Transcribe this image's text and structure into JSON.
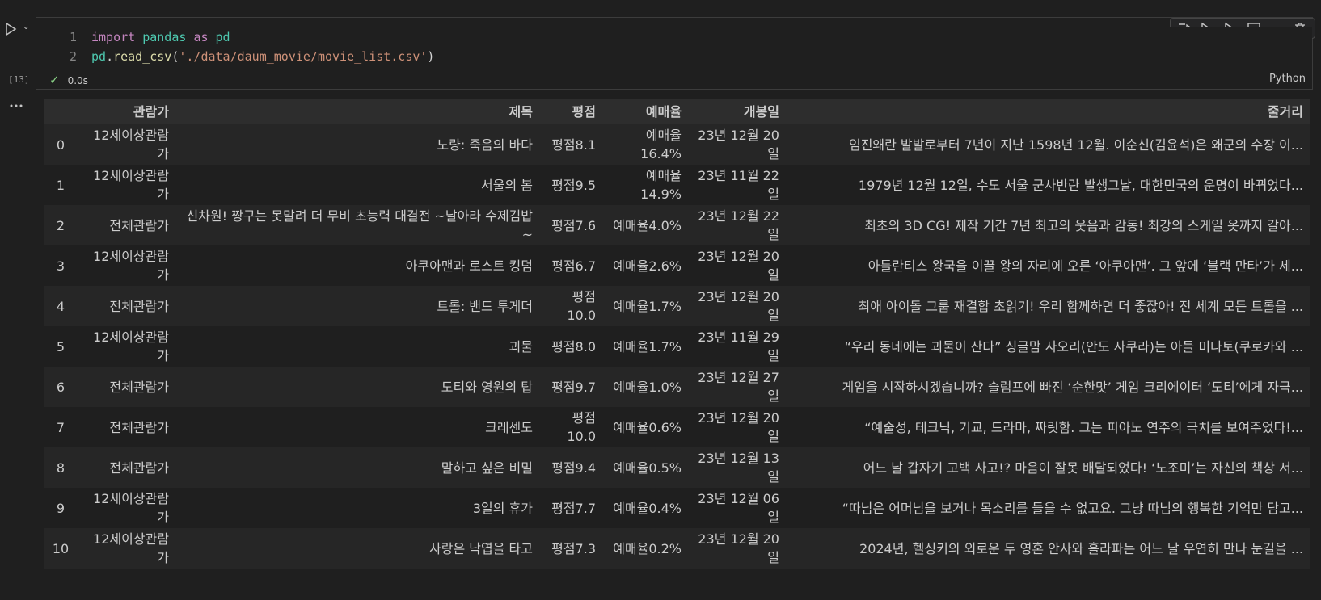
{
  "cell": {
    "execution_count": "[13]",
    "code_lines": [
      {
        "num": "1",
        "tokens": [
          {
            "t": "import",
            "c": "kw"
          },
          {
            "t": " ",
            "c": "pl"
          },
          {
            "t": "pandas",
            "c": "mod"
          },
          {
            "t": " ",
            "c": "pl"
          },
          {
            "t": "as",
            "c": "kw"
          },
          {
            "t": " ",
            "c": "pl"
          },
          {
            "t": "pd",
            "c": "mod"
          }
        ]
      },
      {
        "num": "2",
        "tokens": [
          {
            "t": "pd",
            "c": "mod"
          },
          {
            "t": ".",
            "c": "pl"
          },
          {
            "t": "read_csv",
            "c": "fn"
          },
          {
            "t": "(",
            "c": "pl"
          },
          {
            "t": "'./data/daum_movie/movie_list.csv'",
            "c": "str"
          },
          {
            "t": ")",
            "c": "pl"
          }
        ]
      }
    ],
    "status_time": "0.0s",
    "language": "Python",
    "icons": {
      "run": "play-icon",
      "run_menu": "chevron-down-icon",
      "toolbar": [
        "execute-above-icon",
        "execute-below-icon",
        "run-and-advance-icon",
        "split-cell-icon",
        "more-icon",
        "delete-icon"
      ],
      "output_more": "ellipsis-icon",
      "status": "check-icon"
    },
    "colors": {
      "background": "#1f1f1f",
      "success": "#89d185",
      "header_bg": "#2d2d2d",
      "row_alt": "#262626"
    }
  },
  "table": {
    "columns": [
      "",
      "관람가",
      "제목",
      "평점",
      "예매율",
      "개봉일",
      "줄거리"
    ],
    "rows": [
      [
        "0",
        "12세이상관람가",
        "노량: 죽음의 바다",
        "평점8.1",
        "예매율16.4%",
        "23년 12월 20일",
        "임진왜란 발발로부터 7년이 지난 1598년 12월. 이순신(김윤석)은 왜군의 수장 이..."
      ],
      [
        "1",
        "12세이상관람가",
        "서울의 봄",
        "평점9.5",
        "예매율14.9%",
        "23년 11월 22일",
        "1979년 12월 12일, 수도 서울 군사반란 발생그날, 대한민국의 운명이 바뀌었다..."
      ],
      [
        "2",
        "전체관람가",
        "신차원! 짱구는 못말려 더 무비 초능력 대결전 ~날아라 수제김밥~",
        "평점7.6",
        "예매율4.0%",
        "23년 12월 22일",
        "최초의 3D CG! 제작 기간 7년 최고의 웃음과 감동! 최강의 스케일 옷까지 갈아..."
      ],
      [
        "3",
        "12세이상관람가",
        "아쿠아맨과 로스트 킹덤",
        "평점6.7",
        "예매율2.6%",
        "23년 12월 20일",
        "아틀란티스 왕국을 이끌 왕의 자리에 오른 ‘아쿠아맨’. 그 앞에 ‘블랙 만타’가 세..."
      ],
      [
        "4",
        "전체관람가",
        "트롤: 밴드 투게더",
        "평점10.0",
        "예매율1.7%",
        "23년 12월 20일",
        "최애 아이돌 그룹 재결합 초읽기! 우리 함께하면 더 좋잖아! 전 세계 모든 트롤을 ..."
      ],
      [
        "5",
        "12세이상관람가",
        "괴물",
        "평점8.0",
        "예매율1.7%",
        "23년 11월 29일",
        "“우리 동네에는 괴물이 산다” 싱글맘 사오리(안도 사쿠라)는 아들 미나토(쿠로카와 ..."
      ],
      [
        "6",
        "전체관람가",
        "도티와 영원의 탑",
        "평점9.7",
        "예매율1.0%",
        "23년 12월 27일",
        "게임을 시작하시겠습니까? 슬럼프에 빠진 ‘순한맛’ 게임 크리에이터 ‘도티’에게 자극..."
      ],
      [
        "7",
        "전체관람가",
        "크레센도",
        "평점10.0",
        "예매율0.6%",
        "23년 12월 20일",
        "“예술성, 테크닉, 기교, 드라마, 짜릿함. 그는 피아노 연주의 극치를 보여주었다!..."
      ],
      [
        "8",
        "전체관람가",
        "말하고 싶은 비밀",
        "평점9.4",
        "예매율0.5%",
        "23년 12월 13일",
        "어느 날 갑자기 고백 사고!? 마음이 잘못 배달되었다! ‘노조미’는 자신의 책상 서..."
      ],
      [
        "9",
        "12세이상관람가",
        "3일의 휴가",
        "평점7.7",
        "예매율0.4%",
        "23년 12월 06일",
        "“따님은 어머님을 보거나 목소리를 들을 수 없고요. 그냥 따님의 행복한 기억만 담고..."
      ],
      [
        "10",
        "12세이상관람가",
        "사랑은 낙엽을 타고",
        "평점7.3",
        "예매율0.2%",
        "23년 12월 20일",
        "2024년, 헬싱키의 외로운 두 영혼 안사와 홀라파는 어느 날 우연히 만나 눈길을 ..."
      ]
    ]
  }
}
